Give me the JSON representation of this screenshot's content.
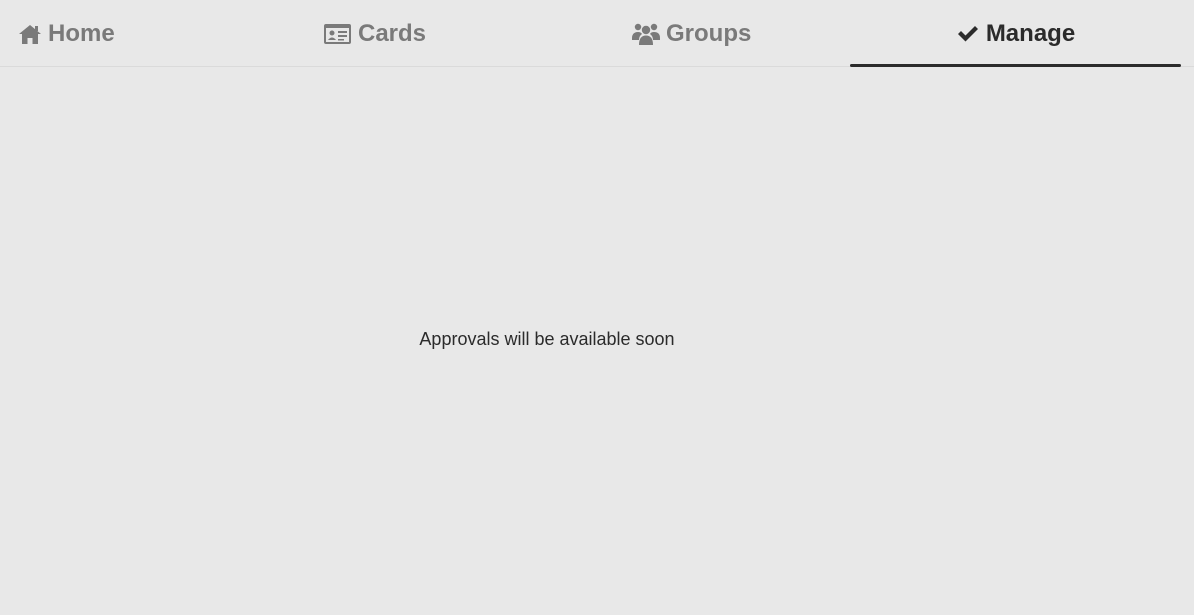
{
  "tabs": [
    {
      "label": "Home",
      "icon": "home-icon"
    },
    {
      "label": "Cards",
      "icon": "id-card-icon"
    },
    {
      "label": "Groups",
      "icon": "users-icon"
    },
    {
      "label": "Manage",
      "icon": "check-icon",
      "active": true
    }
  ],
  "main": {
    "message": "Approvals will be available soon"
  },
  "colors": {
    "background": "#e8e8e8",
    "inactive_tab": "#7a7a7a",
    "active_tab": "#2b2b2b"
  }
}
